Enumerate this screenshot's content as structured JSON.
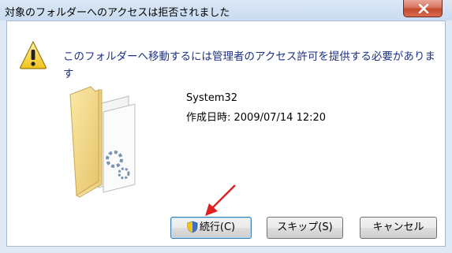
{
  "dialog": {
    "title": "対象のフォルダーへのアクセスは拒否されました",
    "message": "このフォルダーへ移動するには管理者のアクセス許可を提供する必要があります",
    "warning_icon": "warning-icon",
    "folder_icon": "folder-icon"
  },
  "item": {
    "name": "System32",
    "created": "作成日時: 2009/07/14 12:20"
  },
  "buttons": {
    "continue_label": "続行(C)",
    "skip_label": "スキップ(S)",
    "cancel_label": "キャンセル"
  },
  "colors": {
    "message_text": "#1e3287",
    "annotation_arrow": "#e02020",
    "close_button": "#c44a2f"
  }
}
